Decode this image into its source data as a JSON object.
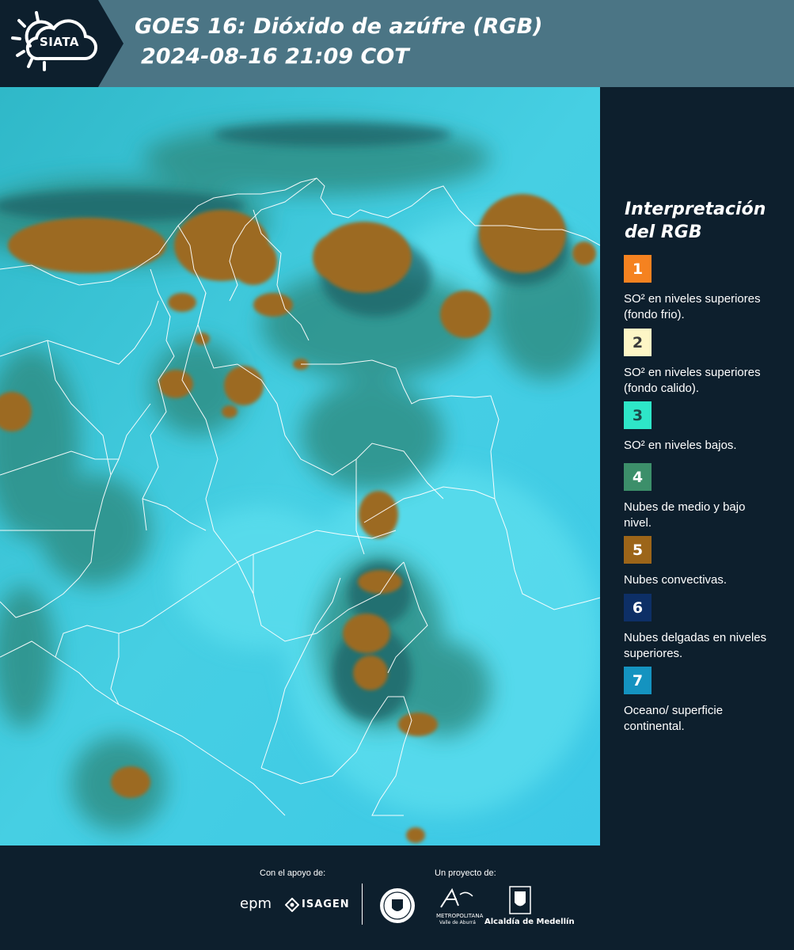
{
  "header": {
    "logo_text": "SIATA",
    "title_line1": "GOES 16: Dióxido de azúfre (RGB)",
    "title_line2": "2024-08-16 21:09 COT"
  },
  "legend": {
    "title": "Interpretación del RGB",
    "items": [
      {
        "number": "1",
        "color": "#f58220",
        "text_color": "#ffffff",
        "label": "SO² en niveles superiores (fondo frio)."
      },
      {
        "number": "2",
        "color": "#fdf6c6",
        "text_color": "#3b3b3b",
        "label": "SO² en niveles superiores (fondo calido)."
      },
      {
        "number": "3",
        "color": "#2ee6c8",
        "text_color": "#1c4a4a",
        "label": "SO² en niveles bajos."
      },
      {
        "number": "4",
        "color": "#3c8f6a",
        "text_color": "#ffffff",
        "label": "Nubes de medio y bajo nivel."
      },
      {
        "number": "5",
        "color": "#9c6519",
        "text_color": "#ffffff",
        "label": "Nubes convectivas."
      },
      {
        "number": "6",
        "color": "#0d2f66",
        "text_color": "#ffffff",
        "label": "Nubes delgadas en niveles superiores."
      },
      {
        "number": "7",
        "color": "#1493c0",
        "text_color": "#ffffff",
        "label": "Oceano/ superficie continental."
      }
    ]
  },
  "footer": {
    "support_label": "Con el apoyo de:",
    "project_label": "Un proyecto de:",
    "epm": "epm",
    "isagen": "ISAGEN",
    "area_line1": "METROPOLITANA",
    "area_line2": "Valle de Aburrá",
    "alcaldia": "Alcaldía de Medellín"
  },
  "colors": {
    "background": "#0d1f2d",
    "header_band": "#4b7585",
    "map_base": "#3fc6dd",
    "convective_clouds": "#9c6519"
  }
}
